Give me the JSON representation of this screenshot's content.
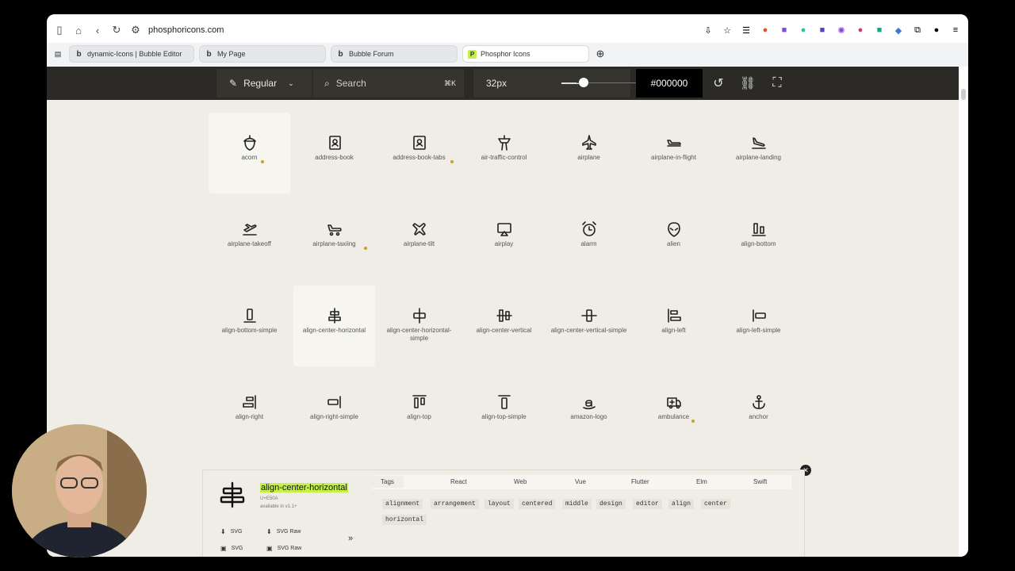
{
  "browser": {
    "url": "phosphoricons.com",
    "tabs": [
      {
        "label": "dynamic-Icons | Bubble Editor",
        "favicon": "b"
      },
      {
        "label": "My Page",
        "favicon": "b"
      },
      {
        "label": "Bubble Forum",
        "favicon": "b"
      },
      {
        "label": "Phosphor Icons",
        "favicon": "P"
      }
    ]
  },
  "toolbar": {
    "weight_label": "Regular",
    "search_placeholder": "Search",
    "search_shortcut": "⌘K",
    "size_label": "32px",
    "size_value": 32,
    "color_value": "#000000"
  },
  "icons": [
    {
      "name": "acorn",
      "dot": true
    },
    {
      "name": "address-book",
      "dot": false
    },
    {
      "name": "address-book-tabs",
      "dot": true
    },
    {
      "name": "air-traffic-control",
      "dot": false
    },
    {
      "name": "airplane",
      "dot": false
    },
    {
      "name": "airplane-in-flight",
      "dot": false
    },
    {
      "name": "airplane-landing",
      "dot": false
    },
    {
      "name": "airplane-takeoff",
      "dot": false
    },
    {
      "name": "airplane-taxiing",
      "dot": true
    },
    {
      "name": "airplane-tilt",
      "dot": false
    },
    {
      "name": "airplay",
      "dot": false
    },
    {
      "name": "alarm",
      "dot": false
    },
    {
      "name": "alien",
      "dot": false
    },
    {
      "name": "align-bottom",
      "dot": false
    },
    {
      "name": "align-bottom-simple",
      "dot": false
    },
    {
      "name": "align-center-horizontal",
      "dot": false
    },
    {
      "name": "align-center-horizontal-simple",
      "dot": false
    },
    {
      "name": "align-center-vertical",
      "dot": false
    },
    {
      "name": "align-center-vertical-simple",
      "dot": false
    },
    {
      "name": "align-left",
      "dot": false
    },
    {
      "name": "align-left-simple",
      "dot": false
    },
    {
      "name": "align-right",
      "dot": false
    },
    {
      "name": "align-right-simple",
      "dot": false
    },
    {
      "name": "align-top",
      "dot": false
    },
    {
      "name": "align-top-simple",
      "dot": false
    },
    {
      "name": "amazon-logo",
      "dot": false
    },
    {
      "name": "ambulance",
      "dot": true
    },
    {
      "name": "anchor",
      "dot": false
    }
  ],
  "detail": {
    "name": "align-center-horizontal",
    "codepoint": "U+E50A",
    "availability": "available in v1.1+",
    "downloads": [
      "SVG",
      "SVG Raw",
      "SVG",
      "SVG Raw"
    ],
    "tabs": [
      "Tags",
      "React",
      "Web",
      "Vue",
      "Flutter",
      "Elm",
      "Swift"
    ],
    "tags": [
      "alignment",
      "arrangement",
      "layout",
      "centered",
      "middle",
      "design",
      "editor",
      "align",
      "center",
      "horizontal"
    ]
  },
  "colors": {
    "accent": "#c5f04a",
    "toolbar": "#2b2a27",
    "background": "#efede5",
    "dot": "#c9a227"
  }
}
